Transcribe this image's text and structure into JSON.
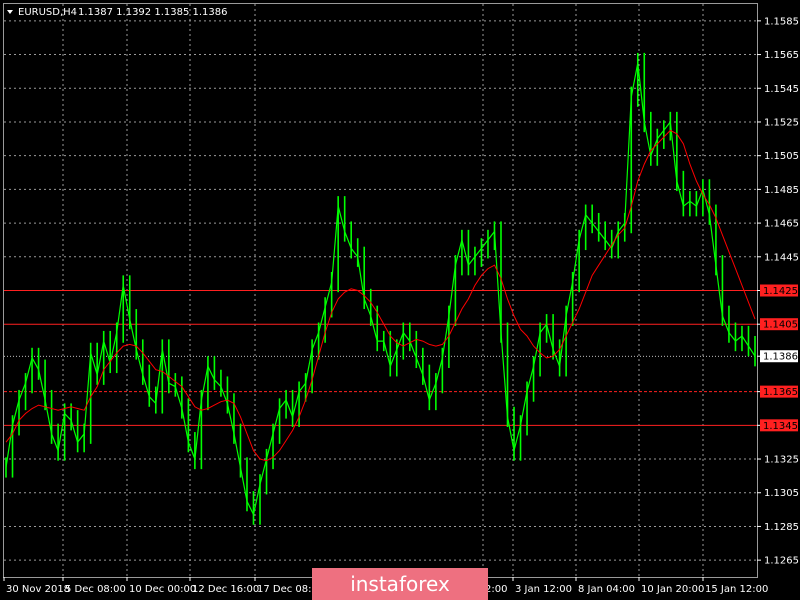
{
  "header": {
    "symbol": "EURUSD,H4",
    "ohlc": "1.1387 1.1392 1.1385 1.1386"
  },
  "watermark": "instaforex",
  "colors": {
    "background": "#000000",
    "grid": "#9a9a9a",
    "candle": "#00ff00",
    "moving_average": "#ff0000",
    "levels": "#ff2020",
    "current_price": "#ffffff",
    "watermark_bg": "#ee7080"
  },
  "chart_data": {
    "type": "line",
    "ylim": [
      1.1255,
      1.1595
    ],
    "y_ticks": [
      "1.1585",
      "1.1565",
      "1.1545",
      "1.1525",
      "1.1505",
      "1.1485",
      "1.1465",
      "1.1445",
      "1.1425",
      "1.1405",
      "1.1386",
      "1.1365",
      "1.1345",
      "1.1325",
      "1.1305",
      "1.1285",
      "1.1265"
    ],
    "x_labels": [
      "30 Nov 2018",
      "5 Dec 08:00",
      "10 Dec 00:00",
      "12 Dec 16:00",
      "17 Dec 08:00",
      "2:00",
      "3 Jan 12:00",
      "8 Jan 04:00",
      "10 Jan 20:00",
      "15 Jan 12:00"
    ],
    "levels": [
      {
        "value": 1.1425,
        "label": "1.1425",
        "style": "solid"
      },
      {
        "value": 1.1405,
        "label": "1.1405",
        "style": "solid"
      },
      {
        "value": 1.1365,
        "label": "1.1365",
        "style": "dashed"
      },
      {
        "value": 1.1345,
        "label": "1.1345",
        "style": "solid"
      }
    ],
    "current_price": {
      "value": 1.1386,
      "label": "1.1386"
    },
    "series": [
      {
        "type": "line",
        "values": [
          1.132,
          1.1345,
          1.136,
          1.137,
          1.1385,
          1.1378,
          1.136,
          1.134,
          1.133,
          1.1352,
          1.1348,
          1.1335,
          1.134,
          1.1388,
          1.1375,
          1.1395,
          1.1382,
          1.14,
          1.1428,
          1.1408,
          1.139,
          1.1375,
          1.1362,
          1.1358,
          1.139,
          1.137,
          1.1368,
          1.1355,
          1.1335,
          1.1325,
          1.136,
          1.138,
          1.1372,
          1.1368,
          1.1358,
          1.134,
          1.132,
          1.13,
          1.1292,
          1.131,
          1.1325,
          1.134,
          1.1355,
          1.136,
          1.135,
          1.1365,
          1.137,
          1.139,
          1.14,
          1.1415,
          1.143,
          1.1475,
          1.146,
          1.145,
          1.1445,
          1.142,
          1.141,
          1.1395,
          1.1395,
          1.138,
          1.139,
          1.14,
          1.1395,
          1.1385,
          1.1375,
          1.136,
          1.137,
          1.1385,
          1.141,
          1.144,
          1.1455,
          1.144,
          1.1445,
          1.145,
          1.1455,
          1.146,
          1.14,
          1.135,
          1.133,
          1.1345,
          1.1365,
          1.138,
          1.14,
          1.1405,
          1.139,
          1.138,
          1.141,
          1.143,
          1.1455,
          1.147,
          1.1465,
          1.146,
          1.1455,
          1.145,
          1.146,
          1.1465,
          1.154,
          1.156,
          1.1525,
          1.1505,
          1.1515,
          1.152,
          1.1525,
          1.149,
          1.1475,
          1.1478,
          1.1475,
          1.1485,
          1.147,
          1.144,
          1.141,
          1.14,
          1.1395,
          1.1398,
          1.1392,
          1.1386
        ]
      },
      {
        "type": "line",
        "values": [
          1.1335,
          1.134,
          1.1348,
          1.1352,
          1.1355,
          1.1357,
          1.1356,
          1.1355,
          1.1354,
          1.1355,
          1.1356,
          1.1355,
          1.1354,
          1.1362,
          1.1368,
          1.1378,
          1.1383,
          1.1388,
          1.1392,
          1.1393,
          1.1392,
          1.1388,
          1.1383,
          1.1378,
          1.1377,
          1.1374,
          1.1371,
          1.1368,
          1.1362,
          1.1356,
          1.1354,
          1.1355,
          1.1357,
          1.1359,
          1.136,
          1.1358,
          1.135,
          1.134,
          1.133,
          1.1325,
          1.1324,
          1.1326,
          1.133,
          1.1336,
          1.1342,
          1.135,
          1.136,
          1.1372,
          1.1386,
          1.14,
          1.1412,
          1.142,
          1.1424,
          1.1426,
          1.1425,
          1.1422,
          1.1418,
          1.1412,
          1.1405,
          1.1398,
          1.1394,
          1.1392,
          1.1394,
          1.1396,
          1.1395,
          1.1393,
          1.1392,
          1.1393,
          1.1398,
          1.1406,
          1.1414,
          1.142,
          1.1428,
          1.1434,
          1.1438,
          1.144,
          1.1432,
          1.142,
          1.141,
          1.1402,
          1.1398,
          1.1392,
          1.1388,
          1.1385,
          1.1386,
          1.139,
          1.1398,
          1.1406,
          1.1414,
          1.1424,
          1.1434,
          1.144,
          1.1446,
          1.1452,
          1.1458,
          1.1462,
          1.1475,
          1.149,
          1.15,
          1.1508,
          1.1512,
          1.1516,
          1.152,
          1.1518,
          1.1512,
          1.15,
          1.149,
          1.1482,
          1.1476,
          1.1468,
          1.1458,
          1.1448,
          1.1438,
          1.1428,
          1.1418,
          1.1408
        ]
      }
    ]
  }
}
